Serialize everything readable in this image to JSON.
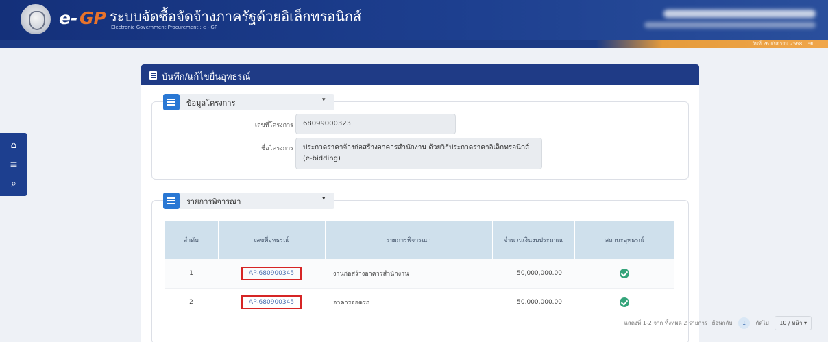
{
  "header": {
    "logo_e": "e-",
    "logo_gp": "GP",
    "title_th": "ระบบจัดซื้อจัดจ้างภาครัฐด้วยอิเล็กทรอนิกส์",
    "title_en": "Electronic Government Procurement : e - GP",
    "date_info": "วันที่ 26 กันยายน 2568",
    "exit_icon": "logout-icon"
  },
  "sidebar": {
    "items": [
      {
        "icon": "home-icon",
        "glyph": "⌂"
      },
      {
        "icon": "menu-icon",
        "glyph": "≡"
      },
      {
        "icon": "search-icon",
        "glyph": "⌕"
      }
    ]
  },
  "panel": {
    "title": "บันทึก/แก้ไขยื่นอุทธรณ์"
  },
  "project_section": {
    "title": "ข้อมูลโครงการ",
    "caret": "▾",
    "project_no_label": "เลขที่โครงการ",
    "project_no": "68099000323",
    "project_name_label": "ชื่อโครงการ",
    "project_name": "ประกวดราคาจ้างก่อสร้างอาคารสำนักงาน ด้วยวิธีประกวดราคาอิเล็กทรอนิกส์ (e-bidding)"
  },
  "consider_section": {
    "title": "รายการพิจารณา",
    "caret": "▾",
    "columns": [
      "ลำดับ",
      "เลขที่อุทธรณ์",
      "รายการพิจารณา",
      "จำนวนเงินงบประมาณ",
      "สถานะอุทธรณ์"
    ],
    "rows": [
      {
        "no": "1",
        "appeal_no": "AP-680900345",
        "item": "งานก่อสร้างอาคารสำนักงาน",
        "amount": "50,000,000.00",
        "status_icon": "check-circle-icon"
      },
      {
        "no": "2",
        "appeal_no": "AP-680900345",
        "item": "อาคารจอดรถ",
        "amount": "50,000,000.00",
        "status_icon": "check-circle-icon"
      }
    ],
    "pager": {
      "summary": "แสดงที่ 1-2 จาก ทั้งหมด 2 รายการ",
      "prev": "ย้อนกลับ",
      "page": "1",
      "next": "ถัดไป",
      "per_page": "10 / หน้า",
      "per_page_caret": "▾"
    }
  },
  "colors": {
    "header_bg": "#1d3f8f",
    "accent_orange": "#e8732b",
    "status_green": "#34a47a",
    "highlight_red": "#d62525"
  }
}
